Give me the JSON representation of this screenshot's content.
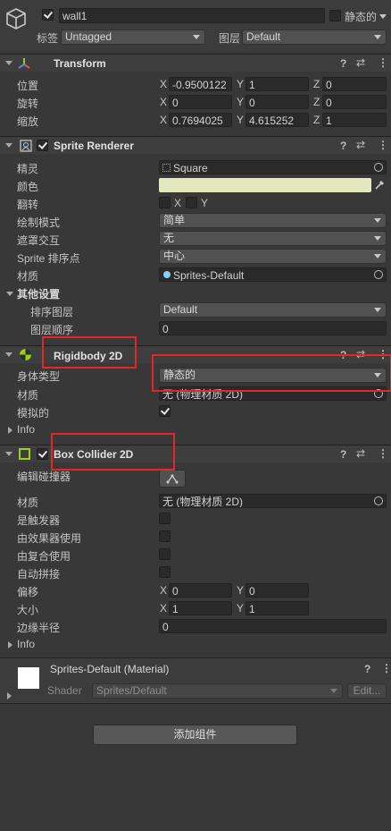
{
  "object": {
    "name": "wall1",
    "static_label": "静态的",
    "tag_label": "标签",
    "tag_value": "Untagged",
    "layer_label": "图层",
    "layer_value": "Default"
  },
  "transform": {
    "title": "Transform",
    "position_label": "位置",
    "rotation_label": "旋转",
    "scale_label": "缩放",
    "position": {
      "x": "-0.9500122",
      "y": "1",
      "z": "0"
    },
    "rotation": {
      "x": "0",
      "y": "0",
      "z": "0"
    },
    "scale": {
      "x": "0.7694025",
      "y": "4.615252",
      "z": "1"
    }
  },
  "axes": {
    "x": "X",
    "y": "Y",
    "z": "Z"
  },
  "sprite_renderer": {
    "title": "Sprite Renderer",
    "sprite_label": "精灵",
    "sprite_value": "Square",
    "color_label": "颜色",
    "color_value": "#e3e9bd",
    "flip_label": "翻转",
    "flip_x": "X",
    "flip_y": "Y",
    "draw_mode_label": "绘制模式",
    "draw_mode_value": "简单",
    "mask_label": "遮罩交互",
    "mask_value": "无",
    "sort_point_label": "Sprite 排序点",
    "sort_point_value": "中心",
    "material_label": "材质",
    "material_value": "Sprites-Default",
    "additional_label": "其他设置",
    "sorting_layer_label": "排序图层",
    "sorting_layer_value": "Default",
    "order_label": "图层顺序",
    "order_value": "0"
  },
  "rigidbody": {
    "title": "Rigidbody 2D",
    "body_type_label": "身体类型",
    "body_type_value": "静态的",
    "material_label": "材质",
    "material_value": "无 (物理材质 2D)",
    "simulated_label": "模拟的",
    "info_label": "Info"
  },
  "box_collider": {
    "title": "Box Collider 2D",
    "edit_label": "编辑碰撞器",
    "material_label": "材质",
    "material_value": "无 (物理材质 2D)",
    "trigger_label": "是触发器",
    "effector_label": "由效果器使用",
    "composite_label": "由复合使用",
    "auto_tiling_label": "自动拼接",
    "offset_label": "偏移",
    "offset": {
      "x": "0",
      "y": "0"
    },
    "size_label": "大小",
    "size": {
      "x": "1",
      "y": "1"
    },
    "edge_radius_label": "边缘半径",
    "edge_radius_value": "0",
    "info_label": "Info"
  },
  "material_section": {
    "title": "Sprites-Default (Material)",
    "shader_label": "Shader",
    "shader_value": "Sprites/Default",
    "edit_button": "Edit..."
  },
  "add_component": "添加组件",
  "icons": {
    "help": "?",
    "settings": "⇄",
    "more": "⋮"
  },
  "colors": {
    "highlight_box": "#e32626",
    "rigidbody_icon": "#9ad01e",
    "collider_icon": "#9ad01e"
  }
}
